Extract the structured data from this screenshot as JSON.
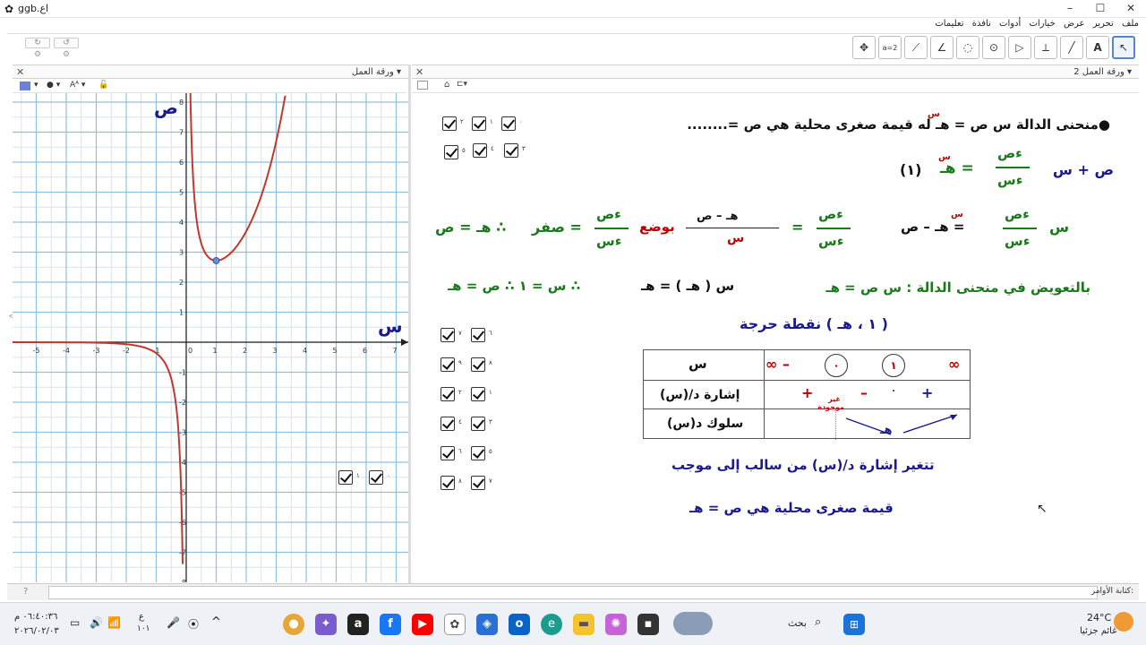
{
  "window": {
    "title": "ggb.اع",
    "minimize": "–",
    "maximize": "☐",
    "close": "✕"
  },
  "menu": [
    "ملف",
    "تحرير",
    "عرض",
    "خيارات",
    "أدوات",
    "نافذة",
    "تعليمات"
  ],
  "panels": {
    "left_title": "ورقة العمل",
    "right_title": "ورقة العمل 2"
  },
  "graph": {
    "y_axis_label": "ص",
    "x_axis_label": "س",
    "x_ticks": [
      "-5",
      "-4",
      "-3",
      "-2",
      "-1",
      "0",
      "1",
      "2",
      "3",
      "4",
      "5",
      "6",
      "7"
    ],
    "y_ticks": [
      "8",
      "7",
      "6",
      "5",
      "4",
      "3",
      "2",
      "1",
      "-1",
      "-2",
      "-3",
      "-4",
      "-5",
      "-6",
      "-7",
      "-8"
    ]
  },
  "worksheet": {
    "line1": "●منحنى الدالة  س ص =  هـ له قيمة صغرى محلية هي ص =........",
    "line1_exp": "س",
    "eq1_left": "ص  +  س",
    "eq1_frac_num": "ءص",
    "eq1_frac_den": "ءس",
    "eq1_right": "=  هـ",
    "eq1_right_exp": "س",
    "eq1_tag": "(١)",
    "eq2_s": "س",
    "eq2_frac_num": "ءص",
    "eq2_frac_den": "ءس",
    "eq2_rhs": "=  هـ  –  ص",
    "eq2_rhs_exp": "س",
    "eq3_frac_num": "ءص",
    "eq3_frac_den": "ءس",
    "eq3_mid_num": "هـ  –  ص",
    "eq3_mid_den": "س",
    "eq3_bw": "بوضع",
    "eq3_frac2_num": "ءص",
    "eq3_frac2_den": "ءس",
    "eq3_zero": "=  صفر",
    "eq3_therefore": "∴  هـ  =  ص",
    "line4_label": "بالتعويض في منحنى الدالة : س ص = هـ",
    "line4_mid": "س  (  هـ  )  =  هـ",
    "line4_right": "∴  س  =  ١   ∴  ص  =  هـ",
    "critical": "( ١ ، هـ ) نقطة حرجة",
    "table": {
      "row1_label": "س",
      "row2_label": "إشارة د/(س)",
      "row3_label": "سلوك د(س)",
      "neg_inf": "– ∞",
      "zero": "٠",
      "one": "١",
      "pos_inf": "∞",
      "plus1": "+",
      "minus": "–",
      "dot": "٠",
      "plus2": "+",
      "undefined_note": "غير موجودة",
      "behaviour_e": "هـ"
    },
    "conclusion1": "تتغير إشارة د/(س) من سالب إلى موجب",
    "conclusion2": "قيمة صغرى محلية هي ص = هـ"
  },
  "checkboxes_top": [
    "٠",
    "١",
    "٢",
    "٣",
    "٤",
    "٥"
  ],
  "checkboxes_mid": [
    "٦",
    "٧",
    "٨",
    "٩",
    "١",
    "٢",
    "٣",
    "٤",
    "٥",
    "٦",
    "٧",
    "٨"
  ],
  "checkboxes_graph": [
    "٠",
    "١"
  ],
  "inputbar": {
    "label": "كتابة الأوامر:"
  },
  "taskbar": {
    "weather_temp": "24°C",
    "weather_text": "غائم جزئيا",
    "search": "بحث",
    "time": "٠٦:٤٠:٣٦ م",
    "date": "٢٠٢٦/٠٢/٠٣",
    "lang_top": "ع",
    "lang_bottom": "١٠١"
  }
}
